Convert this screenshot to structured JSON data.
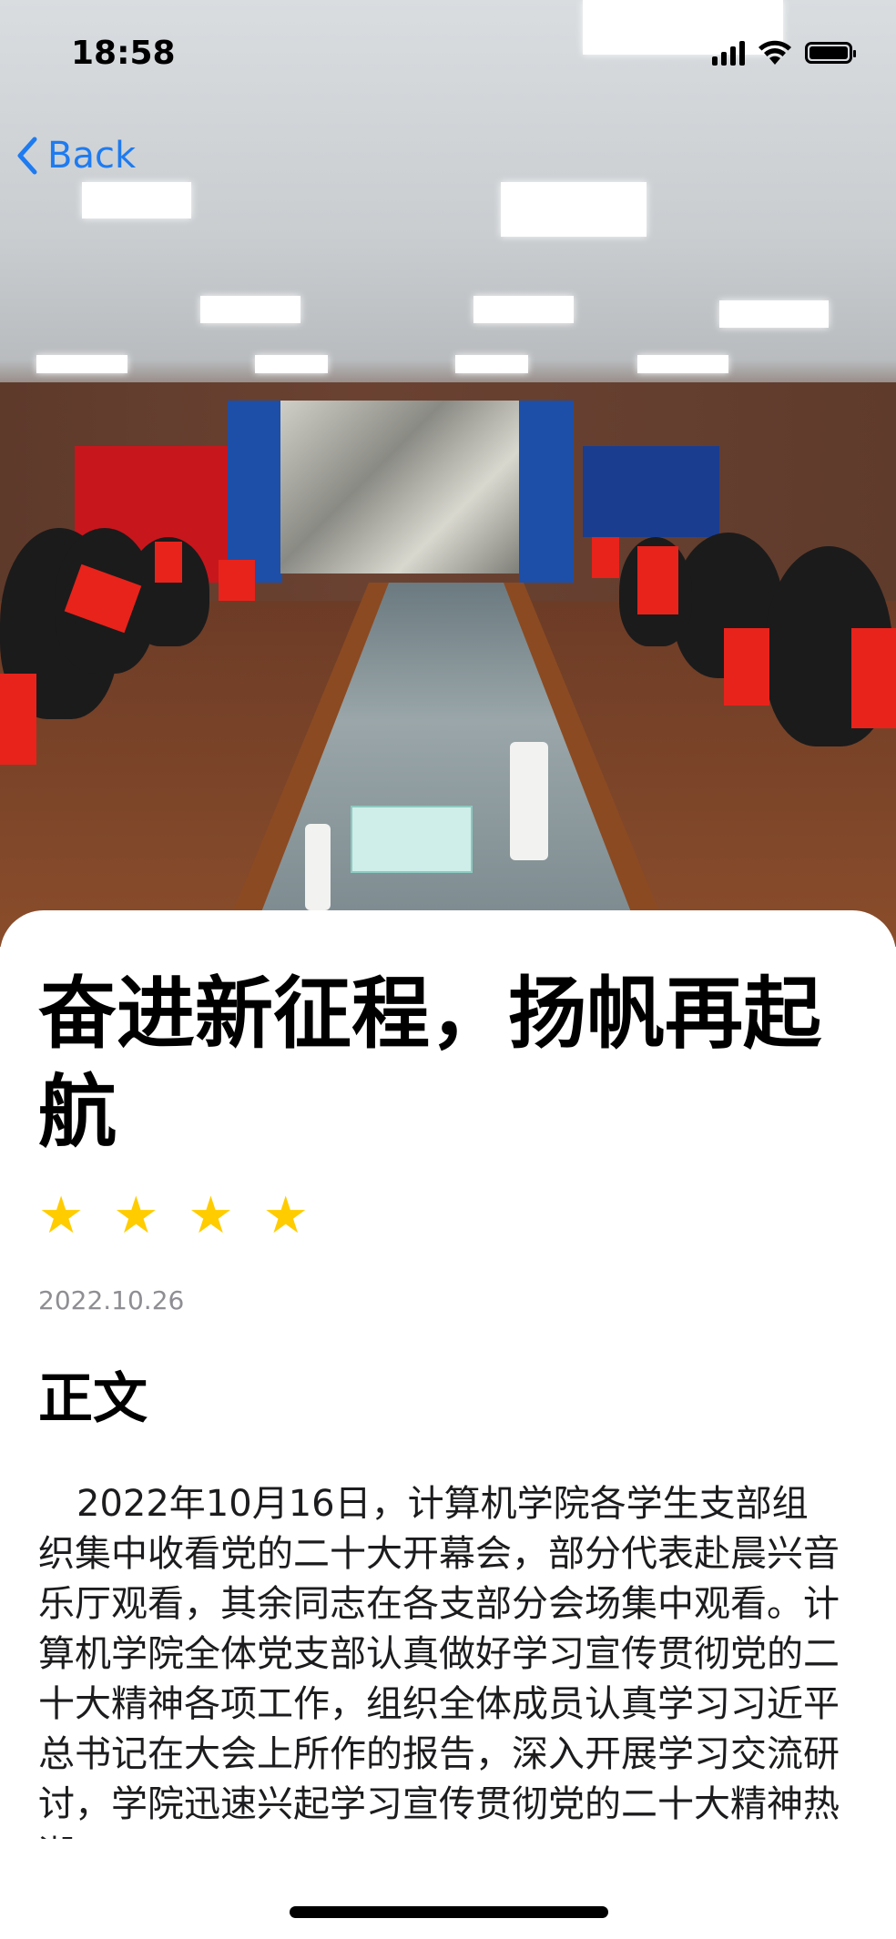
{
  "status_bar": {
    "time": "18:58"
  },
  "nav": {
    "back_label": "Back"
  },
  "article": {
    "title": "奋进新征程，扬帆再起航",
    "rating": 4,
    "date": "2022.10.26",
    "section_heading": "正文",
    "body": "2022年10月16日，计算机学院各学生支部组织集中收看党的二十大开幕会，部分代表赴晨兴音乐厅观看，其余同志在各支部分会场集中观看。计算机学院全体党支部认真做好学习宣传贯彻党的二十大精神各项工作，组织全体成员认真学习习近平总书记在大会上所作的报告，深入开展学习交流研讨，学院迅速兴起学习宣传贯彻党的二十大精神热潮。"
  },
  "colors": {
    "accent": "#1e7bf0",
    "star": "#ffcc00",
    "date_gray": "#8e8e93"
  },
  "icons": {
    "back": "chevron-left-icon",
    "signal": "cellular-signal-icon",
    "wifi": "wifi-icon",
    "battery": "battery-icon",
    "star": "star-icon"
  }
}
